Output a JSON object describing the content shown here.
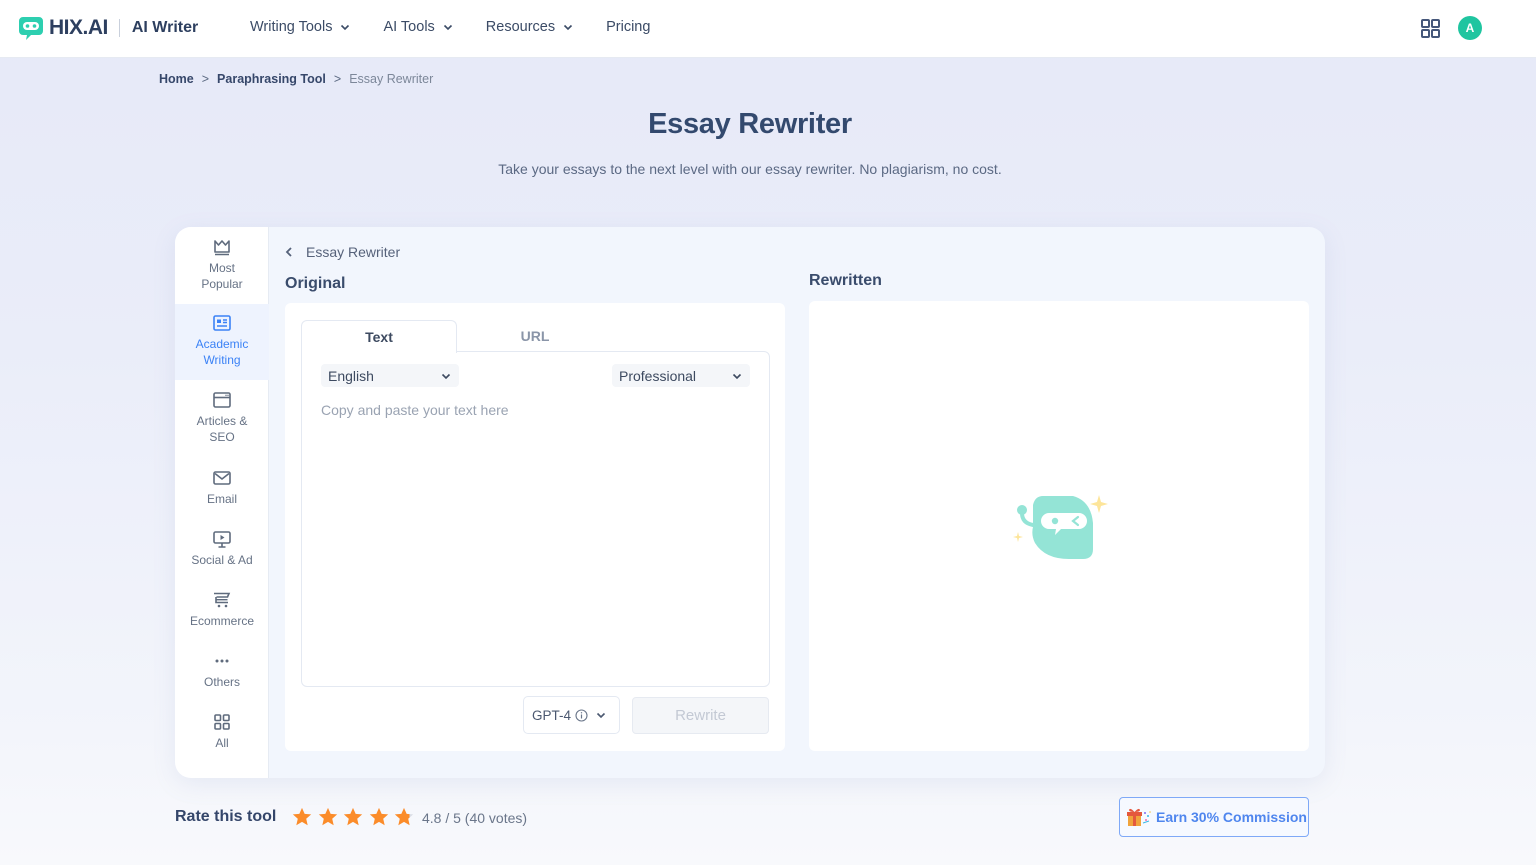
{
  "header": {
    "brand": "HIX.AI",
    "product": "AI Writer",
    "nav": [
      {
        "label": "Writing Tools",
        "has_dropdown": true
      },
      {
        "label": "AI Tools",
        "has_dropdown": true
      },
      {
        "label": "Resources",
        "has_dropdown": true
      },
      {
        "label": "Pricing",
        "has_dropdown": false
      }
    ],
    "avatar_initial": "A",
    "brand_color": "#2dcfb0",
    "avatar_color": "#1fc5a0"
  },
  "breadcrumb": [
    {
      "label": "Home"
    },
    {
      "label": "Paraphrasing Tool"
    },
    {
      "label": "Essay Rewriter"
    }
  ],
  "breadcrumb_separator": ">",
  "page": {
    "title": "Essay Rewriter",
    "subtitle": "Take your essays to the next level with our essay rewriter. No plagiarism, no cost."
  },
  "sidebar": {
    "items": [
      {
        "label": "Most Popular",
        "icon": "crown-icon",
        "active": false
      },
      {
        "label": "Academic Writing",
        "icon": "newspaper-icon",
        "active": true
      },
      {
        "label": "Articles & SEO",
        "icon": "browser-window-icon",
        "active": false
      },
      {
        "label": "Email",
        "icon": "envelope-icon",
        "active": false
      },
      {
        "label": "Social & Ad",
        "icon": "presentation-play-icon",
        "active": false
      },
      {
        "label": "Ecommerce",
        "icon": "cart-icon",
        "active": false
      },
      {
        "label": "Others",
        "icon": "more-dots-icon",
        "active": false
      },
      {
        "label": "All",
        "icon": "grid-icon",
        "active": false
      }
    ]
  },
  "tool": {
    "back_label": "Essay Rewriter",
    "original_title": "Original",
    "rewritten_title": "Rewritten",
    "tabs": [
      {
        "label": "Text",
        "active": true
      },
      {
        "label": "URL",
        "active": false
      }
    ],
    "language": "English",
    "tone": "Professional",
    "input_placeholder": "Copy and paste your text here",
    "model": "GPT-4",
    "rewrite_label": "Rewrite",
    "accent_color": "#3b82f6"
  },
  "rating": {
    "label": "Rate this tool",
    "score": 4.8,
    "max": 5,
    "text": "4.8 / 5 (40 votes)",
    "star_color": "#fb8c2a"
  },
  "affiliate": {
    "label": "Earn 30% Commission"
  }
}
